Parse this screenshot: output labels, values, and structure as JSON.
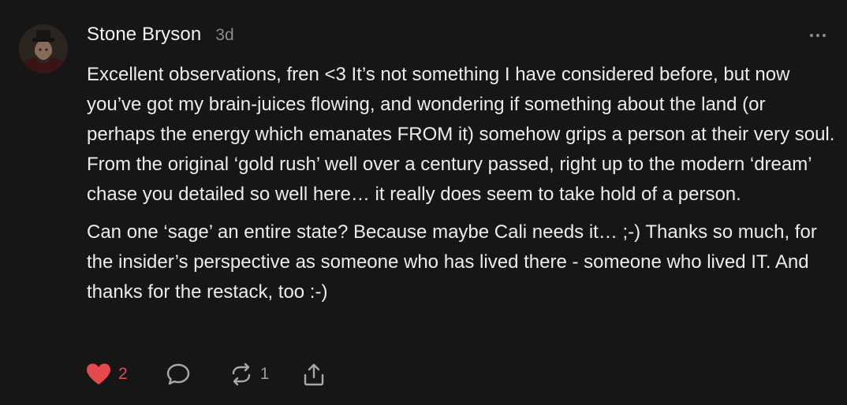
{
  "comment": {
    "author": "Stone Bryson",
    "timestamp": "3d",
    "paragraphs": [
      "Excellent observations, fren <3 It’s not something I have considered before, but now you’ve got my brain-juices flowing, and wondering if something about the land (or perhaps the energy which emanates FROM it) somehow grips a person at their very soul. From the original ‘gold rush’ well over a century passed, right up to the modern ‘dream’ chase you detailed so well here… it really does seem to take hold of a person.",
      "Can one ‘sage’ an entire state? Because maybe Cali needs it… ;-) Thanks so much, for the insider’s perspective as someone who has lived there - someone who lived IT. And thanks for the restack, too :-)"
    ]
  },
  "actions": {
    "like_count": "2",
    "restack_count": "1"
  },
  "icons": {
    "like": "heart-icon",
    "comment": "comment-bubble-icon",
    "restack": "restack-icon",
    "share": "share-icon",
    "more": "more-horizontal-icon"
  },
  "colors": {
    "background": "#161616",
    "text": "#ececec",
    "muted": "#8c8c8c",
    "like": "#e5484d"
  }
}
